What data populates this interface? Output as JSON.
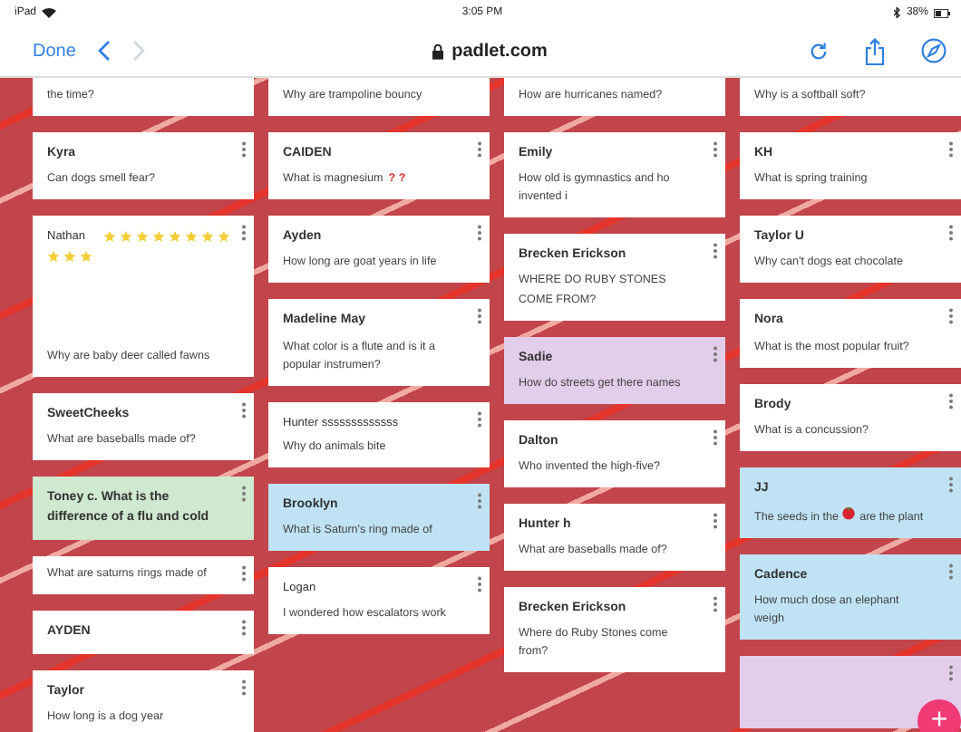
{
  "status_bar": {
    "device": "iPad",
    "time": "3:05 PM",
    "battery": "38%"
  },
  "browser": {
    "done": "Done",
    "back_enabled": true,
    "forward_enabled": false,
    "address": "padlet.com"
  },
  "columns": [
    {
      "posts": [
        {
          "kind": "body",
          "text": "the time?",
          "color": "#ffffff"
        },
        {
          "kind": "titled",
          "author": "Kyra",
          "text": "Can dogs smell fear?",
          "color": "#ffffff"
        },
        {
          "kind": "stickers",
          "author": "Nathan",
          "text": "Why are baby deer called fawns",
          "color": "#ffffff"
        },
        {
          "kind": "titled",
          "author": "SweetCheeks",
          "text": "What are baseballs made of?",
          "color": "#ffffff"
        },
        {
          "kind": "heading",
          "author": "Toney c. What is the difference of a flu and cold",
          "color": "#cfe8d0"
        },
        {
          "kind": "body",
          "text": "What are saturns rings made of",
          "color": "#ffffff"
        },
        {
          "kind": "heading",
          "author": "AYDEN",
          "color": "#ffffff"
        },
        {
          "kind": "titled",
          "author": "Taylor",
          "text": "How long is a dog year",
          "color": "#ffffff"
        }
      ]
    },
    {
      "posts": [
        {
          "kind": "body",
          "text": "Why are trampoline bouncy",
          "color": "#ffffff"
        },
        {
          "kind": "titled",
          "author": "CAIDEN",
          "text": "What is magnesium",
          "marks": "? ?",
          "color": "#ffffff"
        },
        {
          "kind": "titled",
          "author": "Ayden",
          "text": "How long are goat years in life",
          "color": "#ffffff"
        },
        {
          "kind": "titled",
          "author": "Madeline May",
          "text": "What color is a flute and is it a popular instrumen?",
          "color": "#ffffff"
        },
        {
          "kind": "plain",
          "author": "Hunter sssssssssssss",
          "text": "Why do animals bite",
          "color": "#ffffff"
        },
        {
          "kind": "titled",
          "author": "Brooklyn",
          "text": "What is Saturn's ring made of",
          "color": "#bfe3f5"
        },
        {
          "kind": "plain",
          "author": "Logan",
          "text": " I wondered how escalators work",
          "color": "#ffffff"
        }
      ]
    },
    {
      "posts": [
        {
          "kind": "body",
          "text": "How are hurricanes named?",
          "color": "#ffffff"
        },
        {
          "kind": "titled",
          "author": "Emily",
          "text": "How old is gymnastics and ho invented i",
          "color": "#ffffff"
        },
        {
          "kind": "titled",
          "author": "Brecken Erickson",
          "text": "WHERE DO RUBY STONES COME FROM?",
          "color": "#ffffff"
        },
        {
          "kind": "titled",
          "author": "Sadie",
          "text": "How do streets get there names",
          "color": "#e2cdea"
        },
        {
          "kind": "titled",
          "author": "Dalton",
          "text": "Who invented the high-five?",
          "color": "#ffffff"
        },
        {
          "kind": "titled",
          "author": "Hunter h",
          "text": "What are baseballs made of?",
          "color": "#ffffff"
        },
        {
          "kind": "titled",
          "author": "Brecken Erickson",
          "text": "Where do Ruby Stones come from?",
          "color": "#ffffff"
        }
      ]
    },
    {
      "posts": [
        {
          "kind": "body",
          "text": "Why is a softball soft?",
          "color": "#ffffff"
        },
        {
          "kind": "titled",
          "author": "KH",
          "text": "What is spring training",
          "color": "#ffffff"
        },
        {
          "kind": "titled",
          "author": "Taylor U",
          "text": "Why can't dogs eat chocolate",
          "color": "#ffffff"
        },
        {
          "kind": "titled",
          "author": "Nora",
          "text": "What is the most popular fruit?",
          "color": "#ffffff"
        },
        {
          "kind": "titled",
          "author": "Brody",
          "text": "What is a concussion?",
          "color": "#ffffff"
        },
        {
          "kind": "berry",
          "author": "JJ",
          "text": "The seeds in the",
          "text_after": "are the plant",
          "color": "#bfe3f5"
        },
        {
          "kind": "titled",
          "author": "Cadence",
          "text": "How much dose an elephant weigh",
          "color": "#bfe3f5"
        },
        {
          "kind": "blank",
          "color": "#e2cdea"
        }
      ]
    }
  ],
  "add_button": {
    "label": "+"
  }
}
